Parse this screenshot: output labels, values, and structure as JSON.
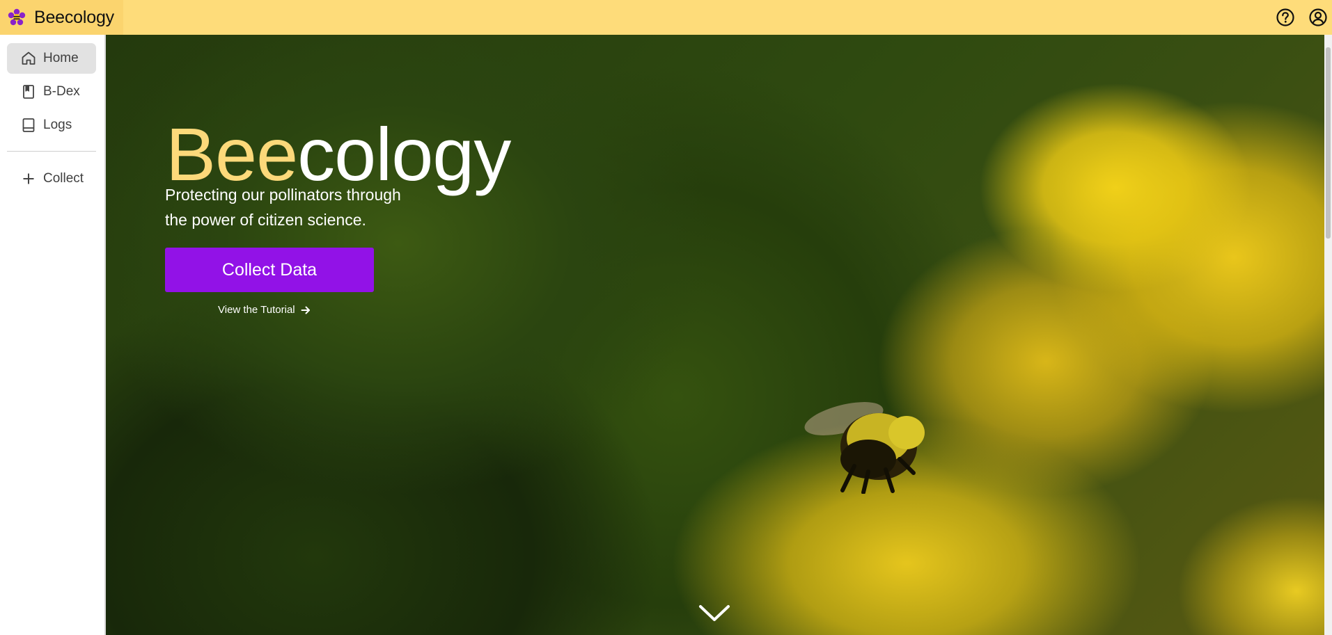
{
  "app": {
    "name": "Beecology",
    "brand_color": "#fedc7a",
    "accent_color": "#9212e7"
  },
  "topbar": {
    "logo_icon": "bee-flower-logo-icon",
    "help_icon": "help-circle-icon",
    "account_icon": "account-circle-icon"
  },
  "sidebar": {
    "items": [
      {
        "label": "Home",
        "icon": "home-icon",
        "active": true
      },
      {
        "label": "B-Dex",
        "icon": "bookmark-book-icon",
        "active": false
      },
      {
        "label": "Logs",
        "icon": "logbook-icon",
        "active": false
      }
    ],
    "collect": {
      "label": "Collect",
      "icon": "plus-icon"
    }
  },
  "hero": {
    "title_part1": "Bee",
    "title_part2": "cology",
    "subtitle_line1": "Protecting our pollinators through",
    "subtitle_line2": "the power of citizen science.",
    "cta_label": "Collect Data",
    "tutorial_label": "View the Tutorial",
    "tutorial_icon": "arrow-right-icon",
    "scroll_icon": "chevron-down-icon"
  }
}
